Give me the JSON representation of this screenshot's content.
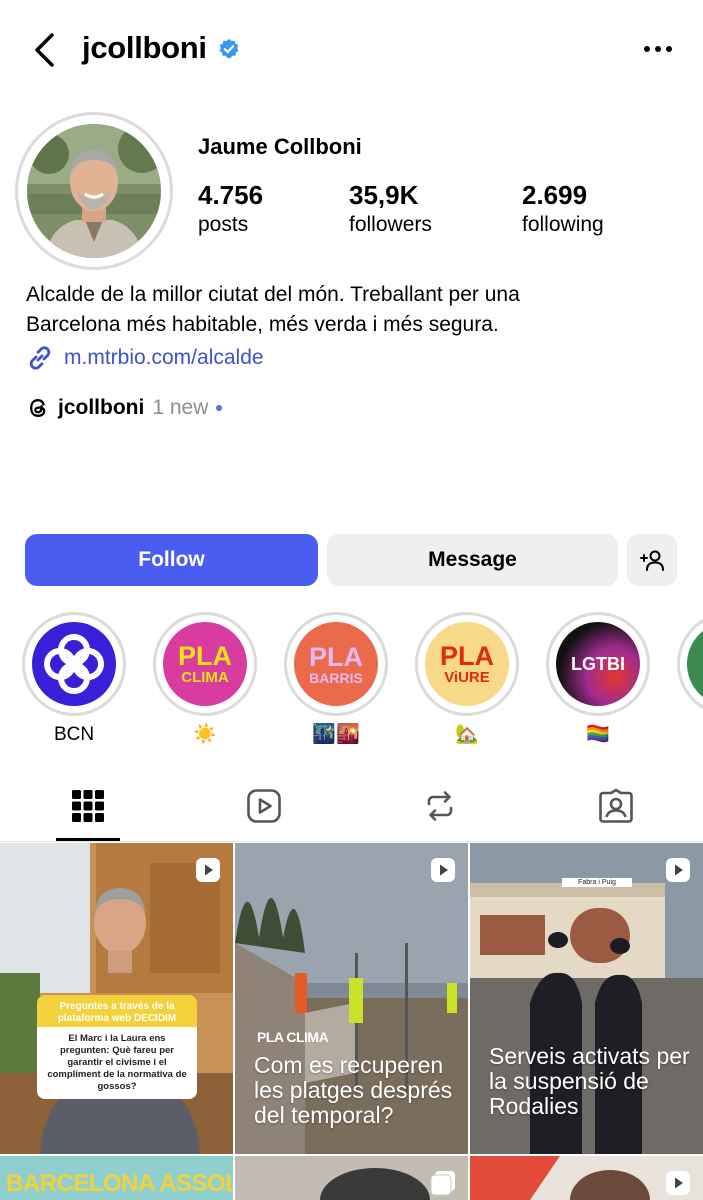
{
  "header": {
    "username": "jcollboni"
  },
  "profile": {
    "full_name": "Jaume Collboni",
    "stats": [
      {
        "value": "4.756",
        "label": "posts"
      },
      {
        "value": "35,9K",
        "label": "followers"
      },
      {
        "value": "2.699",
        "label": "following"
      }
    ],
    "bio_line1": "Alcalde de la millor ciutat del món. Treballant per una",
    "bio_line2": "Barcelona més habitable, més verda i més segura.",
    "link": "m.mtrbio.com/alcalde",
    "threads_name": "jcollboni",
    "threads_new": "1 new"
  },
  "actions": {
    "follow": "Follow",
    "message": "Message"
  },
  "highlights": [
    {
      "label": "BCN",
      "badge_top": "",
      "badge_bottom": ""
    },
    {
      "label": "☀️",
      "badge_top": "PLA",
      "badge_bottom": "CLIMA"
    },
    {
      "label": "🌃🌇",
      "badge_top": "PLA",
      "badge_bottom": "BARRIS"
    },
    {
      "label": "🏡",
      "badge_top": "PLA",
      "badge_bottom": "ViURE"
    },
    {
      "label": "🏳️‍🌈",
      "badge_top": "LGTBI",
      "badge_bottom": ""
    }
  ],
  "posts": [
    {
      "card_title": "Preguntes a través de la plataforma web DECIDIM",
      "card_body": "El Marc i la Laura ens pregunten: Què fareu per garantir el civisme i el compliment de la normativa de gossos?"
    },
    {
      "tag": "PLA CLIMA",
      "caption": "Com es recuperen les platges després del temporal?"
    },
    {
      "caption": "Serveis activats per la suspensió de Rodalies",
      "station_sign": "Fabra i Puig"
    },
    {
      "banner": "BARCELONA ASSOLEIX"
    }
  ],
  "colors": {
    "accent": "#4a5df1",
    "link": "#3c54c8",
    "verified": "#3897f0"
  }
}
